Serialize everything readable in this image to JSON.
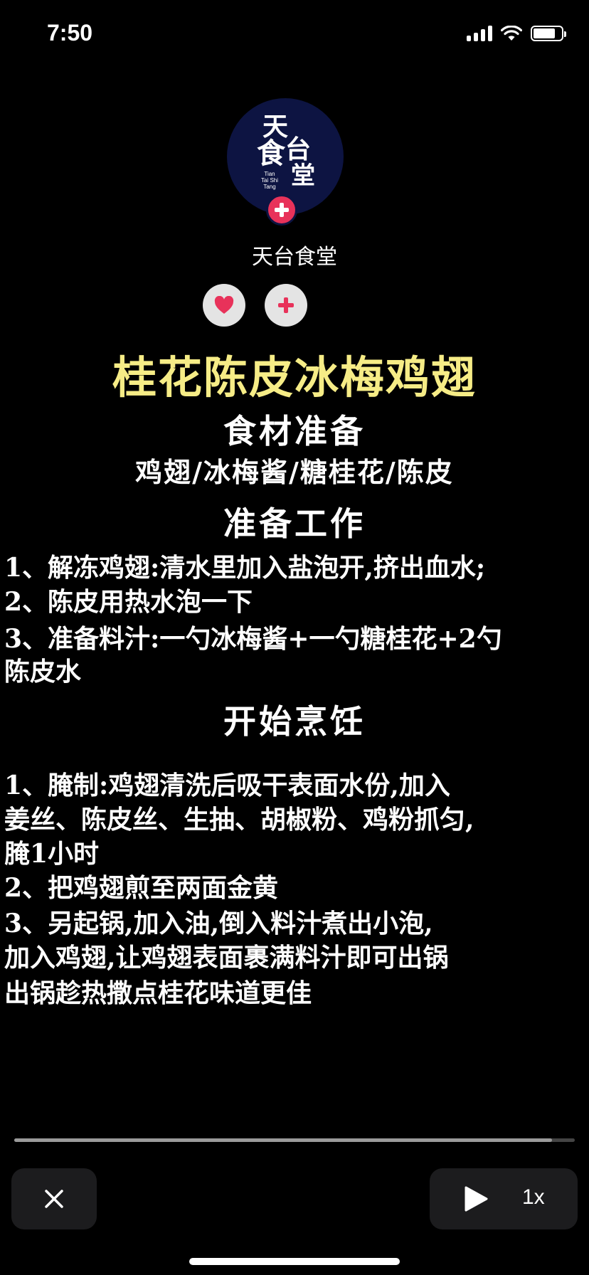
{
  "status_bar": {
    "time": "7:50",
    "battery_level": 0.8
  },
  "account": {
    "logo_chars": [
      "天",
      "食",
      "台",
      "堂"
    ],
    "logo_sub": "Tian Tai Shi Tang",
    "name": "天台食堂"
  },
  "actions": {
    "like_icon": "heart-icon",
    "follow_icon": "plus-icon"
  },
  "recipe": {
    "title": "桂花陈皮冰梅鸡翅",
    "ingredients_heading": "食材准备",
    "ingredients": "鸡翅/冰梅酱/糖桂花/陈皮",
    "prep_heading": "准备工作",
    "prep_steps": [
      "1、解冻鸡翅:清水里加入盐泡开,挤出血水;",
      "2、陈皮用热水泡一下",
      "3、准备料汁:一勺冰梅酱+一勺糖桂花+2勺",
      "陈皮水"
    ],
    "cook_heading": "开始烹饪",
    "cook_steps": [
      "1、腌制:鸡翅清洗后吸干表面水份,加入",
      "姜丝、陈皮丝、生抽、胡椒粉、鸡粉抓匀,",
      "腌1小时",
      "2、把鸡翅煎至两面金黄",
      "3、另起锅,加入油,倒入料汁煮出小泡,",
      "加入鸡翅,让鸡翅表面裹满料汁即可出锅",
      "出锅趁热撒点桂花味道更佳"
    ]
  },
  "player": {
    "progress": 0.96,
    "speed": "1x"
  },
  "colors": {
    "title": "#f6ec86",
    "accent": "#e8325a",
    "logo_bg": "#0d1442"
  }
}
